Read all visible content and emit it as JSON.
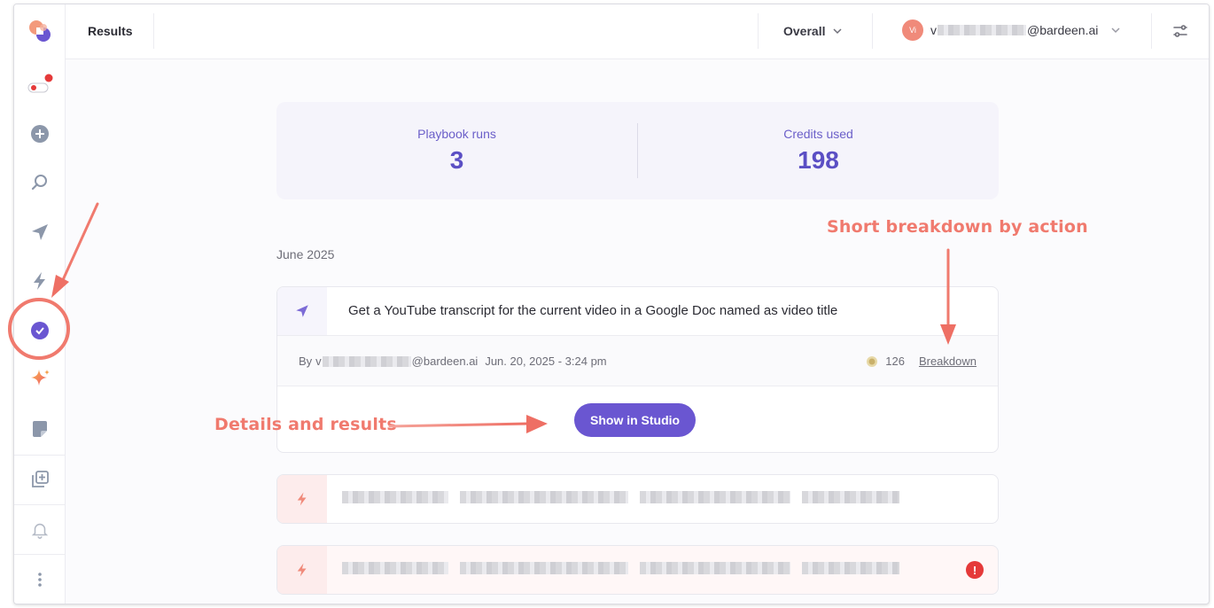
{
  "header": {
    "title": "Results",
    "scope_select": "Overall",
    "user": {
      "avatar_initials": "Vi",
      "email_prefix": "v",
      "email_domain": "@bardeen.ai"
    }
  },
  "stats": {
    "playbook_runs_label": "Playbook runs",
    "playbook_runs_value": "3",
    "credits_used_label": "Credits used",
    "credits_used_value": "198"
  },
  "month_label": "June 2025",
  "runs": [
    {
      "title": "Get a YouTube transcript for the current video in a Google Doc named as video title",
      "by_label": "By",
      "user_prefix": "v",
      "user_domain": "@bardeen.ai",
      "date": "Jun. 20, 2025 - 3:24 pm",
      "credits": "126",
      "breakdown_label": "Breakdown",
      "action_label": "Show in Studio"
    }
  ],
  "annotations": {
    "breakdown_note": "Short breakdown by action",
    "details_note": "Details and results"
  },
  "colors": {
    "accent": "#6a56d1",
    "annotation": "#f07a6e",
    "error": "#e53939"
  },
  "icons": {
    "sidebar": [
      "bardeen-logo-icon",
      "toggle-icon",
      "add-circle-icon",
      "search-icon",
      "send-icon",
      "lightning-icon",
      "check-circle-icon",
      "sparkle-icon",
      "sticky-note-icon",
      "duplicate-add-icon",
      "bell-icon",
      "more-vertical-icon"
    ]
  }
}
